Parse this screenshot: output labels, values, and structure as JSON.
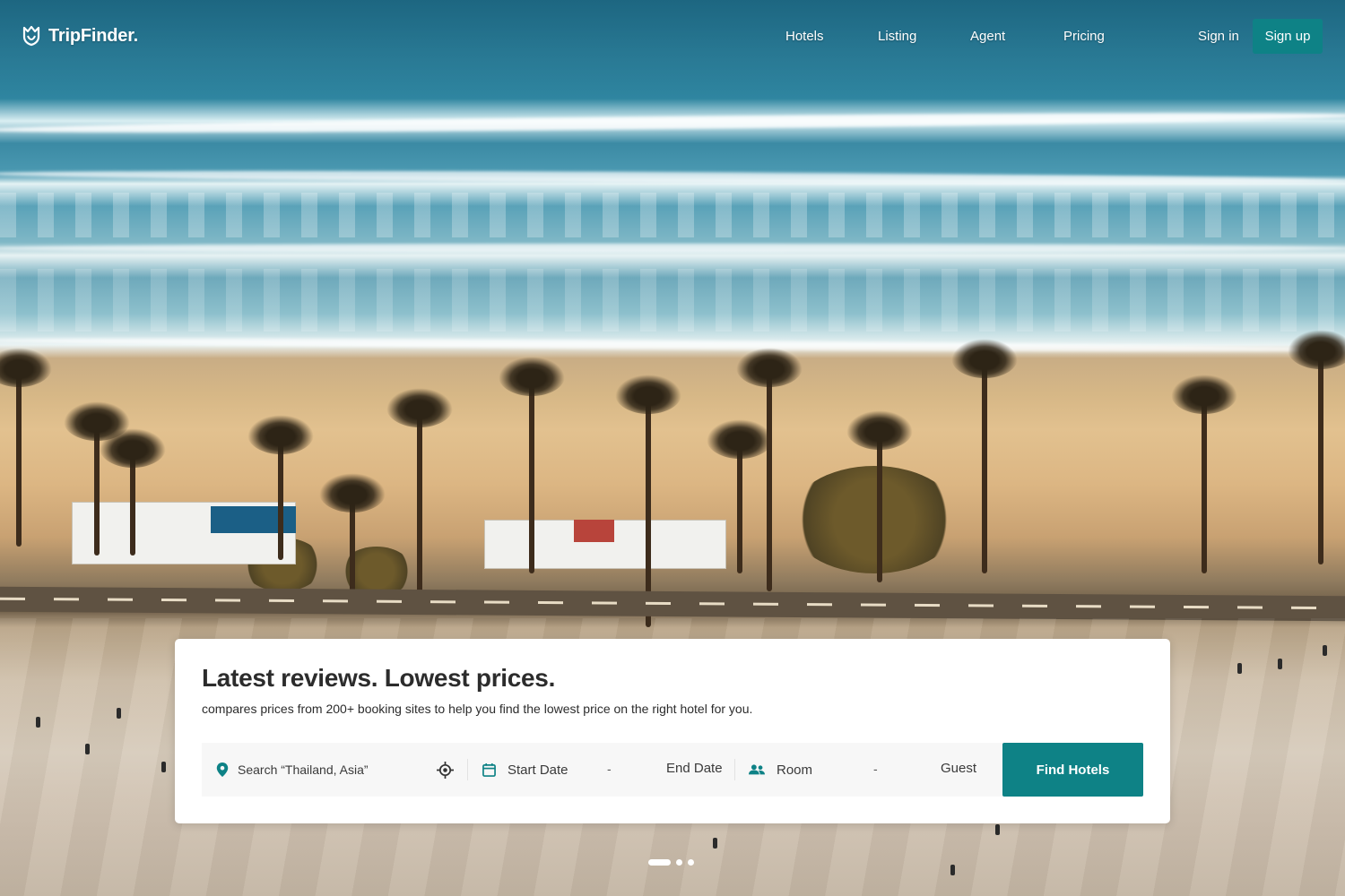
{
  "brand": {
    "name": "TripFinder.",
    "logo_icon": "tulip-shield-icon"
  },
  "nav": {
    "links": [
      "Hotels",
      "Listing",
      "Agent",
      "Pricing"
    ],
    "sign_in": "Sign in",
    "sign_up": "Sign up"
  },
  "hero": {
    "title": "Latest reviews. Lowest prices.",
    "subtitle": "compares prices from 200+ booking sites to help you find the lowest price on the right hotel for you."
  },
  "search": {
    "location_placeholder": "Search “Thailand, Asia”",
    "location_icon": "map-pin-icon",
    "locate_icon": "crosshair-icon",
    "date_icon": "calendar-icon",
    "start_date": "Start Date",
    "date_separator": "-",
    "end_date": "End Date",
    "guest_icon": "users-icon",
    "room_label": "Room",
    "guest_separator": "-",
    "guest_label": "Guest",
    "submit": "Find Hotels"
  },
  "slider": {
    "total": 3,
    "active_index": 0
  },
  "colors": {
    "accent": "#0e8286",
    "text": "#2c2c2c",
    "search_bg": "#f7f7f7"
  }
}
